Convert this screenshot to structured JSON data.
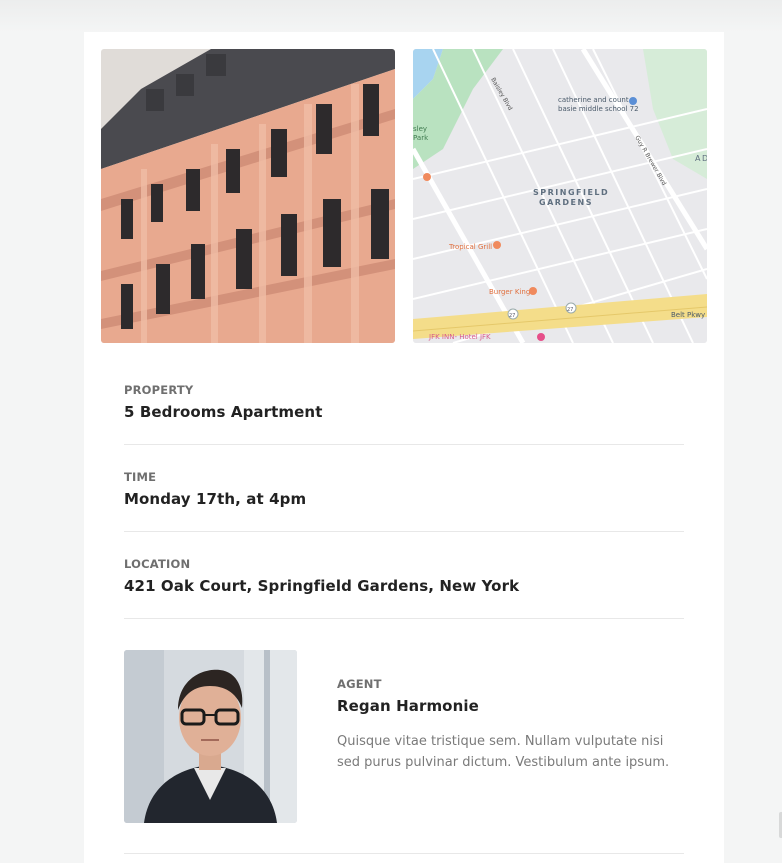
{
  "property": {
    "label": "PROPERTY",
    "value": "5 Bedrooms Apartment"
  },
  "time": {
    "label": "TIME",
    "value": "Monday 17th, at 4pm"
  },
  "location": {
    "label": "LOCATION",
    "value": "421 Oak Court, Springfield Gardens, New York"
  },
  "agent": {
    "label": "AGENT",
    "name": "Regan Harmonie",
    "bio": "Quisque vitae tristique sem. Nullam vulputate nisi sed purus pulvinar dictum. Vestibulum ante ipsum."
  },
  "map": {
    "area_line1": "SPRINGFIELD",
    "area_line2": "GARDENS",
    "school_line1": "catherine and count",
    "school_line2": "basie middle school 72",
    "park_line1": "sley",
    "park_line2": "Park",
    "grill": "Tropical Grill",
    "burger": "Burger King",
    "hotel": "JFK INN- Hotel JFK",
    "pkwy": "Belt Pkwy",
    "ad": "AD",
    "road1": "Baisley Blvd",
    "road2": "Guy R Brewer Blvd",
    "shield1": "27",
    "shield2": "27"
  },
  "colors": {
    "background": "#f4f5f5",
    "card": "#ffffff",
    "building": "#e8a98f",
    "map_road_major": "#f4dd8a",
    "map_park": "#b9e2c0",
    "map_water": "#a8d4f0"
  }
}
